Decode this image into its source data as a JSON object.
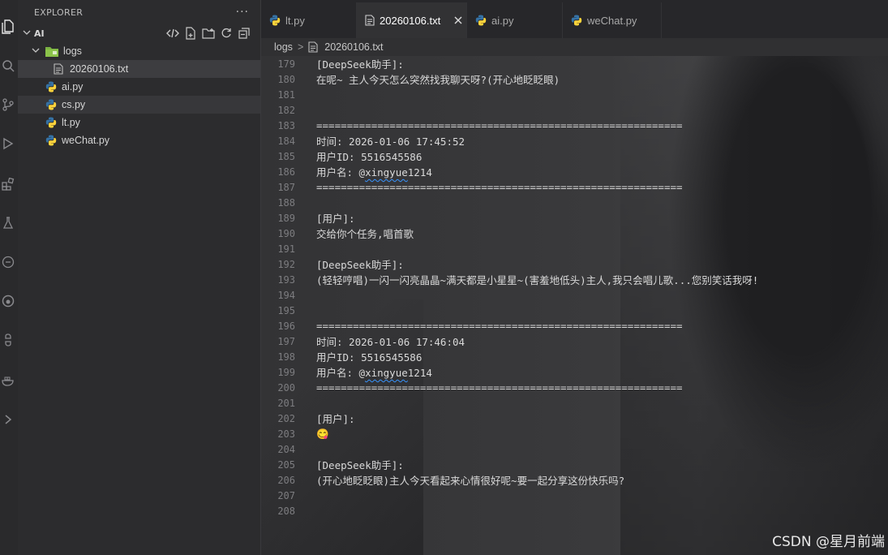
{
  "sidebar": {
    "title": "EXPLORER",
    "more": "···",
    "root_folder": "AI",
    "items": [
      {
        "label": "logs",
        "type": "folder"
      },
      {
        "label": "20260106.txt",
        "type": "txt"
      },
      {
        "label": "ai.py",
        "type": "py"
      },
      {
        "label": "cs.py",
        "type": "py"
      },
      {
        "label": "lt.py",
        "type": "py"
      },
      {
        "label": "weChat.py",
        "type": "py"
      }
    ]
  },
  "tabs": [
    {
      "label": "lt.py",
      "type": "py"
    },
    {
      "label": "20260106.txt",
      "type": "txt",
      "active": true
    },
    {
      "label": "ai.py",
      "type": "py"
    },
    {
      "label": "weChat.py",
      "type": "py"
    }
  ],
  "breadcrumb": {
    "folder": "logs",
    "separator": ">",
    "file": "20260106.txt"
  },
  "editor": {
    "lines": [
      {
        "n": "179",
        "t": "[DeepSeek助手]:"
      },
      {
        "n": "180",
        "t": "在呢~ 主人今天怎么突然找我聊天呀?(开心地眨眨眼)"
      },
      {
        "n": "181",
        "t": ""
      },
      {
        "n": "182",
        "t": ""
      },
      {
        "n": "183",
        "t": "============================================================"
      },
      {
        "n": "184",
        "t": "时间: 2026-01-06 17:45:52"
      },
      {
        "n": "185",
        "t": "用户ID: 5516545586"
      },
      {
        "n": "186",
        "t": "用户名: @xingyue1214"
      },
      {
        "n": "187",
        "t": "============================================================"
      },
      {
        "n": "188",
        "t": ""
      },
      {
        "n": "189",
        "t": "[用户]:"
      },
      {
        "n": "190",
        "t": "交给你个任务,唱首歌"
      },
      {
        "n": "191",
        "t": ""
      },
      {
        "n": "192",
        "t": "[DeepSeek助手]:"
      },
      {
        "n": "193",
        "t": "(轻轻哼唱)一闪一闪亮晶晶~满天都是小星星~(害羞地低头)主人,我只会唱儿歌...您别笑话我呀!"
      },
      {
        "n": "194",
        "t": ""
      },
      {
        "n": "195",
        "t": ""
      },
      {
        "n": "196",
        "t": "============================================================"
      },
      {
        "n": "197",
        "t": "时间: 2026-01-06 17:46:04"
      },
      {
        "n": "198",
        "t": "用户ID: 5516545586"
      },
      {
        "n": "199",
        "t": "用户名: @xingyue1214"
      },
      {
        "n": "200",
        "t": "============================================================"
      },
      {
        "n": "201",
        "t": ""
      },
      {
        "n": "202",
        "t": "[用户]:"
      },
      {
        "n": "203",
        "t": "😋"
      },
      {
        "n": "204",
        "t": ""
      },
      {
        "n": "205",
        "t": "[DeepSeek助手]:"
      },
      {
        "n": "206",
        "t": "(开心地眨眨眼)主人今天看起来心情很好呢~要一起分享这份快乐吗?"
      },
      {
        "n": "207",
        "t": ""
      },
      {
        "n": "208",
        "t": ""
      }
    ]
  },
  "watermark": "CSDN @星月前端",
  "colors": {
    "python_blue": "#3572A5",
    "python_yellow": "#FFD43B",
    "folder_green": "#8bc34a",
    "link_squiggle": "#3794ff"
  }
}
